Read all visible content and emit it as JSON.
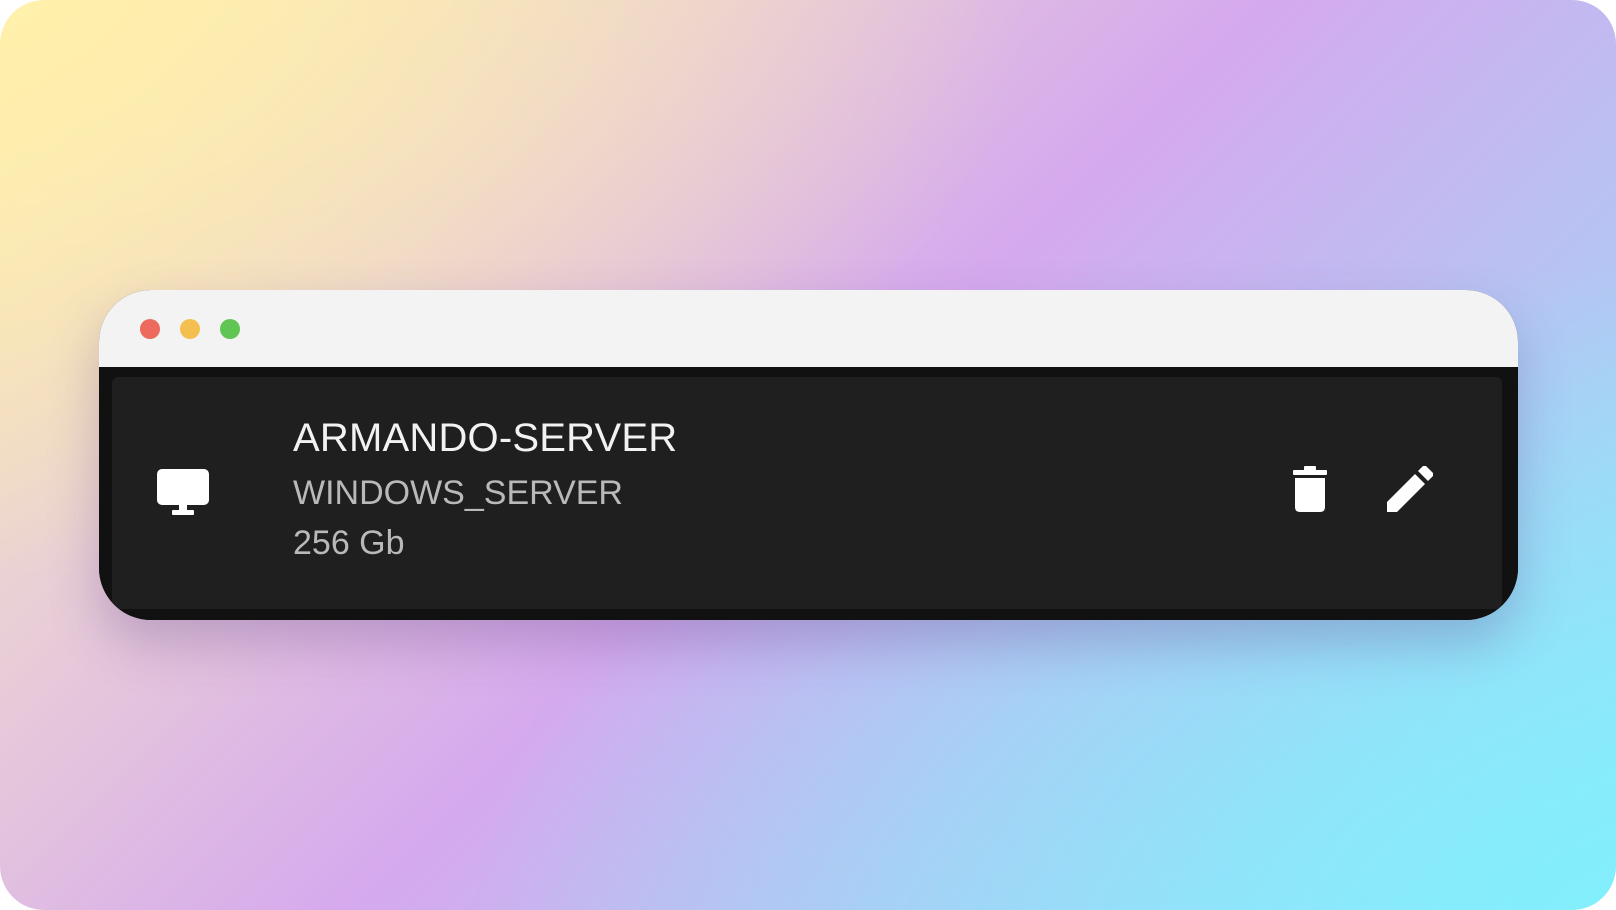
{
  "window": {
    "controls": [
      "close",
      "minimize",
      "maximize"
    ]
  },
  "server": {
    "name": "ARMANDO-SERVER",
    "type": "WINDOWS_SERVER",
    "size": "256 Gb",
    "icon": "desktop-monitor-icon"
  },
  "actions": {
    "delete_icon": "trash-icon",
    "edit_icon": "pencil-icon"
  },
  "colors": {
    "card_background": "#1f1f1f",
    "window_background": "#111111",
    "titlebar": "#f3f3f3",
    "close_dot": "#ec6a5e",
    "minimize_dot": "#f4bf4f",
    "maximize_dot": "#61c554"
  }
}
